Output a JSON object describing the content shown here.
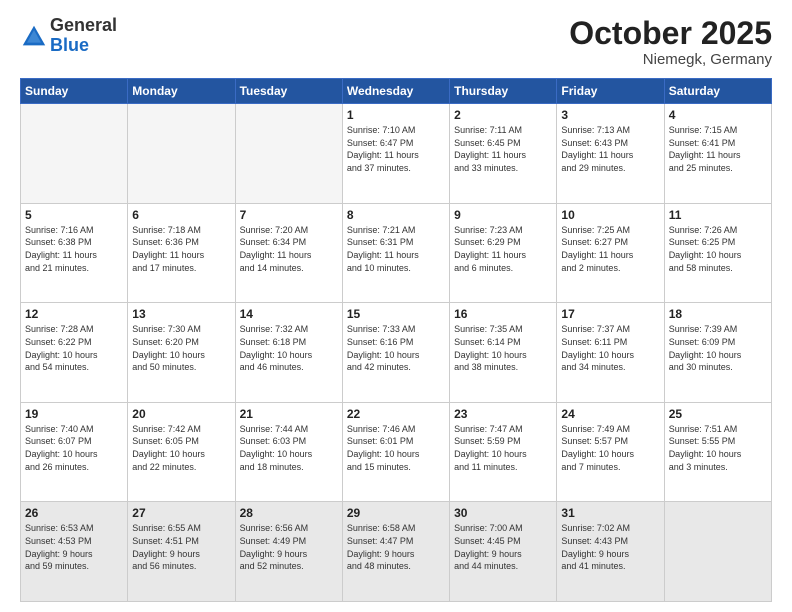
{
  "header": {
    "logo_general": "General",
    "logo_blue": "Blue",
    "month_title": "October 2025",
    "subtitle": "Niemegk, Germany"
  },
  "days_of_week": [
    "Sunday",
    "Monday",
    "Tuesday",
    "Wednesday",
    "Thursday",
    "Friday",
    "Saturday"
  ],
  "weeks": [
    [
      {
        "day": null,
        "info": null
      },
      {
        "day": null,
        "info": null
      },
      {
        "day": null,
        "info": null
      },
      {
        "day": "1",
        "info": "Sunrise: 7:10 AM\nSunset: 6:47 PM\nDaylight: 11 hours\nand 37 minutes."
      },
      {
        "day": "2",
        "info": "Sunrise: 7:11 AM\nSunset: 6:45 PM\nDaylight: 11 hours\nand 33 minutes."
      },
      {
        "day": "3",
        "info": "Sunrise: 7:13 AM\nSunset: 6:43 PM\nDaylight: 11 hours\nand 29 minutes."
      },
      {
        "day": "4",
        "info": "Sunrise: 7:15 AM\nSunset: 6:41 PM\nDaylight: 11 hours\nand 25 minutes."
      }
    ],
    [
      {
        "day": "5",
        "info": "Sunrise: 7:16 AM\nSunset: 6:38 PM\nDaylight: 11 hours\nand 21 minutes."
      },
      {
        "day": "6",
        "info": "Sunrise: 7:18 AM\nSunset: 6:36 PM\nDaylight: 11 hours\nand 17 minutes."
      },
      {
        "day": "7",
        "info": "Sunrise: 7:20 AM\nSunset: 6:34 PM\nDaylight: 11 hours\nand 14 minutes."
      },
      {
        "day": "8",
        "info": "Sunrise: 7:21 AM\nSunset: 6:31 PM\nDaylight: 11 hours\nand 10 minutes."
      },
      {
        "day": "9",
        "info": "Sunrise: 7:23 AM\nSunset: 6:29 PM\nDaylight: 11 hours\nand 6 minutes."
      },
      {
        "day": "10",
        "info": "Sunrise: 7:25 AM\nSunset: 6:27 PM\nDaylight: 11 hours\nand 2 minutes."
      },
      {
        "day": "11",
        "info": "Sunrise: 7:26 AM\nSunset: 6:25 PM\nDaylight: 10 hours\nand 58 minutes."
      }
    ],
    [
      {
        "day": "12",
        "info": "Sunrise: 7:28 AM\nSunset: 6:22 PM\nDaylight: 10 hours\nand 54 minutes."
      },
      {
        "day": "13",
        "info": "Sunrise: 7:30 AM\nSunset: 6:20 PM\nDaylight: 10 hours\nand 50 minutes."
      },
      {
        "day": "14",
        "info": "Sunrise: 7:32 AM\nSunset: 6:18 PM\nDaylight: 10 hours\nand 46 minutes."
      },
      {
        "day": "15",
        "info": "Sunrise: 7:33 AM\nSunset: 6:16 PM\nDaylight: 10 hours\nand 42 minutes."
      },
      {
        "day": "16",
        "info": "Sunrise: 7:35 AM\nSunset: 6:14 PM\nDaylight: 10 hours\nand 38 minutes."
      },
      {
        "day": "17",
        "info": "Sunrise: 7:37 AM\nSunset: 6:11 PM\nDaylight: 10 hours\nand 34 minutes."
      },
      {
        "day": "18",
        "info": "Sunrise: 7:39 AM\nSunset: 6:09 PM\nDaylight: 10 hours\nand 30 minutes."
      }
    ],
    [
      {
        "day": "19",
        "info": "Sunrise: 7:40 AM\nSunset: 6:07 PM\nDaylight: 10 hours\nand 26 minutes."
      },
      {
        "day": "20",
        "info": "Sunrise: 7:42 AM\nSunset: 6:05 PM\nDaylight: 10 hours\nand 22 minutes."
      },
      {
        "day": "21",
        "info": "Sunrise: 7:44 AM\nSunset: 6:03 PM\nDaylight: 10 hours\nand 18 minutes."
      },
      {
        "day": "22",
        "info": "Sunrise: 7:46 AM\nSunset: 6:01 PM\nDaylight: 10 hours\nand 15 minutes."
      },
      {
        "day": "23",
        "info": "Sunrise: 7:47 AM\nSunset: 5:59 PM\nDaylight: 10 hours\nand 11 minutes."
      },
      {
        "day": "24",
        "info": "Sunrise: 7:49 AM\nSunset: 5:57 PM\nDaylight: 10 hours\nand 7 minutes."
      },
      {
        "day": "25",
        "info": "Sunrise: 7:51 AM\nSunset: 5:55 PM\nDaylight: 10 hours\nand 3 minutes."
      }
    ],
    [
      {
        "day": "26",
        "info": "Sunrise: 6:53 AM\nSunset: 4:53 PM\nDaylight: 9 hours\nand 59 minutes."
      },
      {
        "day": "27",
        "info": "Sunrise: 6:55 AM\nSunset: 4:51 PM\nDaylight: 9 hours\nand 56 minutes."
      },
      {
        "day": "28",
        "info": "Sunrise: 6:56 AM\nSunset: 4:49 PM\nDaylight: 9 hours\nand 52 minutes."
      },
      {
        "day": "29",
        "info": "Sunrise: 6:58 AM\nSunset: 4:47 PM\nDaylight: 9 hours\nand 48 minutes."
      },
      {
        "day": "30",
        "info": "Sunrise: 7:00 AM\nSunset: 4:45 PM\nDaylight: 9 hours\nand 44 minutes."
      },
      {
        "day": "31",
        "info": "Sunrise: 7:02 AM\nSunset: 4:43 PM\nDaylight: 9 hours\nand 41 minutes."
      },
      {
        "day": null,
        "info": null
      }
    ]
  ]
}
